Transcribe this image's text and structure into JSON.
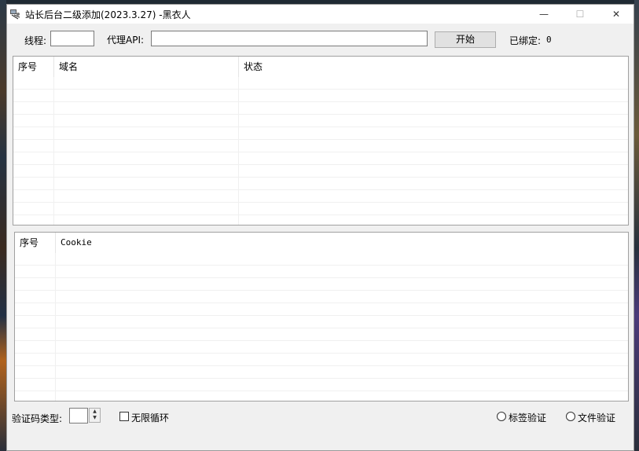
{
  "window": {
    "title": "站长后台二级添加(2023.3.27) -黑衣人",
    "minimize_glyph": "—",
    "maximize_glyph": "☐",
    "close_glyph": "✕"
  },
  "toolbar": {
    "threads_label": "线程:",
    "threads_value": "",
    "proxy_label": "代理API:",
    "proxy_value": "",
    "start_label": "开始",
    "bound_label": "已绑定:",
    "bound_count": "0"
  },
  "domain_list": {
    "columns": [
      "序号",
      "域名",
      "状态"
    ],
    "rows": []
  },
  "cookie_list": {
    "columns": [
      "序号",
      "Cookie"
    ],
    "rows": []
  },
  "bottom": {
    "captcha_type_label": "验证码类型:",
    "captcha_type_value": "",
    "infinite_loop_label": "无限循环",
    "infinite_loop_checked": false,
    "tag_verify_label": "标签验证",
    "file_verify_label": "文件验证"
  }
}
